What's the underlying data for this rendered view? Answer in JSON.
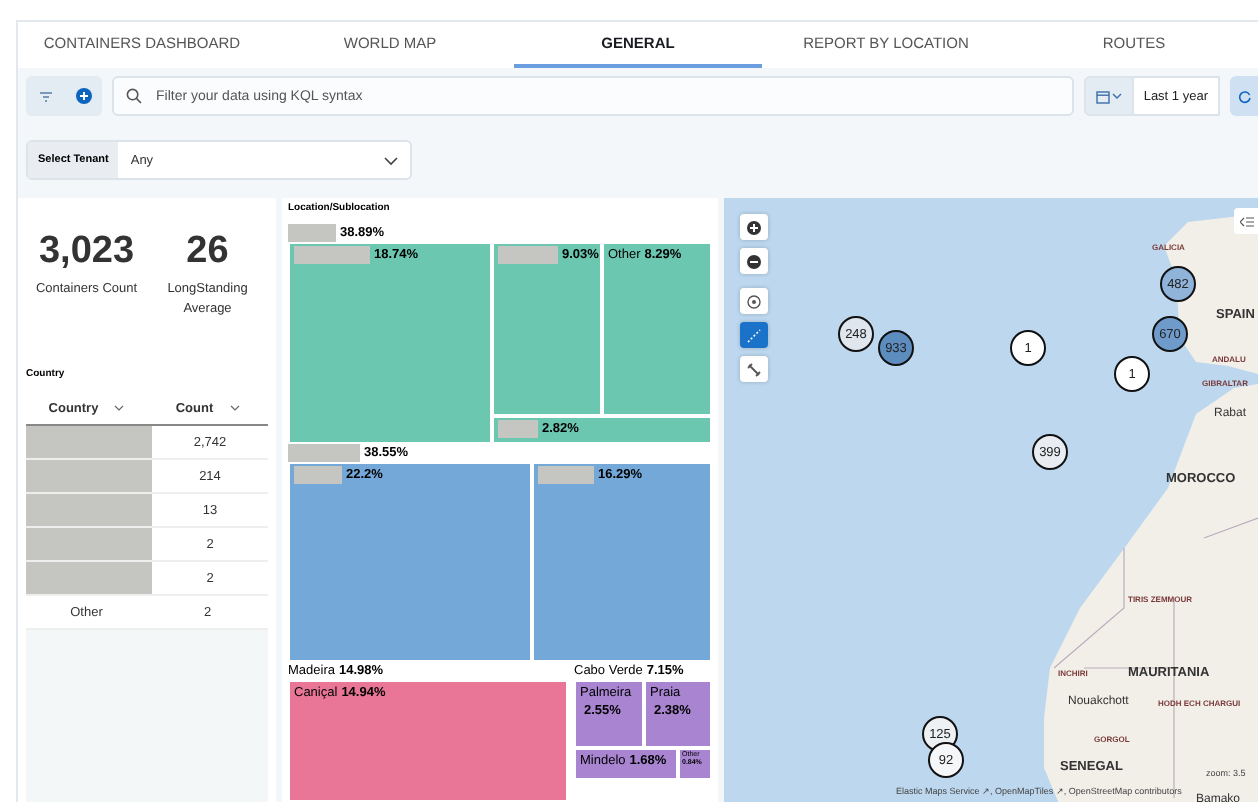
{
  "tabs": [
    {
      "label": "CONTAINERS DASHBOARD",
      "selected": false
    },
    {
      "label": "WORLD MAP",
      "selected": false
    },
    {
      "label": "GENERAL",
      "selected": true
    },
    {
      "label": "REPORT BY LOCATION",
      "selected": false
    },
    {
      "label": "ROUTES",
      "selected": false
    }
  ],
  "query": {
    "placeholder": "Filter your data using KQL syntax",
    "time_range": "Last 1 year"
  },
  "tenant": {
    "label": "Select Tenant",
    "value": "Any"
  },
  "metrics": [
    {
      "value": "3,023",
      "label": "Containers Count"
    },
    {
      "value": "26",
      "label": "LongStanding Average"
    }
  ],
  "country_table": {
    "title": "Country",
    "columns": [
      "Country",
      "Count"
    ],
    "rows": [
      {
        "count": "2,742"
      },
      {
        "count": "214"
      },
      {
        "count": "13"
      },
      {
        "count": "2"
      },
      {
        "count": "2"
      },
      {
        "country": "Other",
        "count": "2"
      }
    ]
  },
  "treemap": {
    "title": "Location/Sublocation",
    "groups": [
      {
        "pct": "38.89%",
        "color": "#6cc7b0",
        "children": [
          {
            "pct": "18.74%"
          },
          {
            "pct": "9.03%"
          },
          {
            "name": "Other",
            "pct": "8.29%"
          },
          {
            "pct": "2.82%"
          }
        ]
      },
      {
        "pct": "38.55%",
        "color": "#74a8d8",
        "children": [
          {
            "pct": "22.2%"
          },
          {
            "pct": "16.29%"
          }
        ]
      },
      {
        "name": "Madeira",
        "pct": "14.98%",
        "color": "#e97696",
        "children": [
          {
            "name": "Caniçal",
            "pct": "14.94%"
          }
        ]
      },
      {
        "name": "Cabo Verde",
        "pct": "7.15%",
        "color": "#a884d1",
        "children": [
          {
            "name": "Palmeira",
            "pct": "2.55%"
          },
          {
            "name": "Praia",
            "pct": "2.38%"
          },
          {
            "name": "Mindelo",
            "pct": "1.68%"
          },
          {
            "name": "Other",
            "pct": "0.84%"
          }
        ]
      }
    ]
  },
  "map": {
    "clusters": [
      {
        "count": "248",
        "color": "#dfe6ee"
      },
      {
        "count": "933",
        "color": "#5d8dbf"
      },
      {
        "count": "1",
        "color": "#ffffff"
      },
      {
        "count": "1",
        "color": "#ffffff"
      },
      {
        "count": "399",
        "color": "#e9edf2"
      },
      {
        "count": "482",
        "color": "#8fb3d9"
      },
      {
        "count": "670",
        "color": "#6f9bcb"
      },
      {
        "count": "125",
        "color": "#eef1f4"
      },
      {
        "count": "92",
        "color": "#f5f6f8"
      }
    ],
    "labels": [
      {
        "text": "GALICIA",
        "kind": "region"
      },
      {
        "text": "SPAIN",
        "kind": "country"
      },
      {
        "text": "ANDALU",
        "kind": "region"
      },
      {
        "text": "GIBRALTAR",
        "kind": "region"
      },
      {
        "text": "Rabat",
        "kind": "city"
      },
      {
        "text": "MOROCCO",
        "kind": "country"
      },
      {
        "text": "TIRIS ZEMMOUR",
        "kind": "region"
      },
      {
        "text": "INCHIRI",
        "kind": "region"
      },
      {
        "text": "MAURITANIA",
        "kind": "country"
      },
      {
        "text": "Nouakchott",
        "kind": "city"
      },
      {
        "text": "HODH ECH CHARGUI",
        "kind": "region"
      },
      {
        "text": "GORGOL",
        "kind": "region"
      },
      {
        "text": "SENEGAL",
        "kind": "country"
      },
      {
        "text": "Bamako",
        "kind": "city"
      }
    ],
    "zoom_label": "zoom: 3.5",
    "attribution": "Elastic Maps Service ↗, OpenMapTiles ↗, OpenStreetMap contributors",
    "tools": [
      {
        "kind": "zoom_in",
        "selected": false
      },
      {
        "kind": "zoom_out",
        "selected": false
      },
      {
        "kind": "locate",
        "selected": false
      },
      {
        "kind": "draw",
        "selected": true
      },
      {
        "kind": "tools",
        "selected": false
      }
    ]
  }
}
